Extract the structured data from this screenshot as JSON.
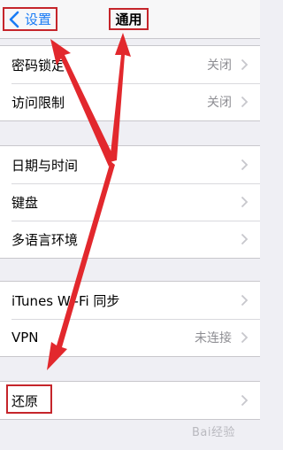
{
  "navbar": {
    "back_label": "设置",
    "title": "通用"
  },
  "group1": [
    {
      "label": "密码锁定",
      "value": "关闭"
    },
    {
      "label": "访问限制",
      "value": "关闭"
    }
  ],
  "group2": [
    {
      "label": "日期与时间",
      "value": ""
    },
    {
      "label": "键盘",
      "value": ""
    },
    {
      "label": "多语言环境",
      "value": ""
    }
  ],
  "group3": [
    {
      "label": "iTunes Wi-Fi 同步",
      "value": ""
    },
    {
      "label": "VPN",
      "value": "未连接"
    }
  ],
  "group4": [
    {
      "label": "还原",
      "value": ""
    }
  ],
  "watermark": "Bai经验",
  "colors": {
    "accent": "#1a7cf5",
    "annotation": "#e2282d",
    "background": "#efeff4"
  }
}
